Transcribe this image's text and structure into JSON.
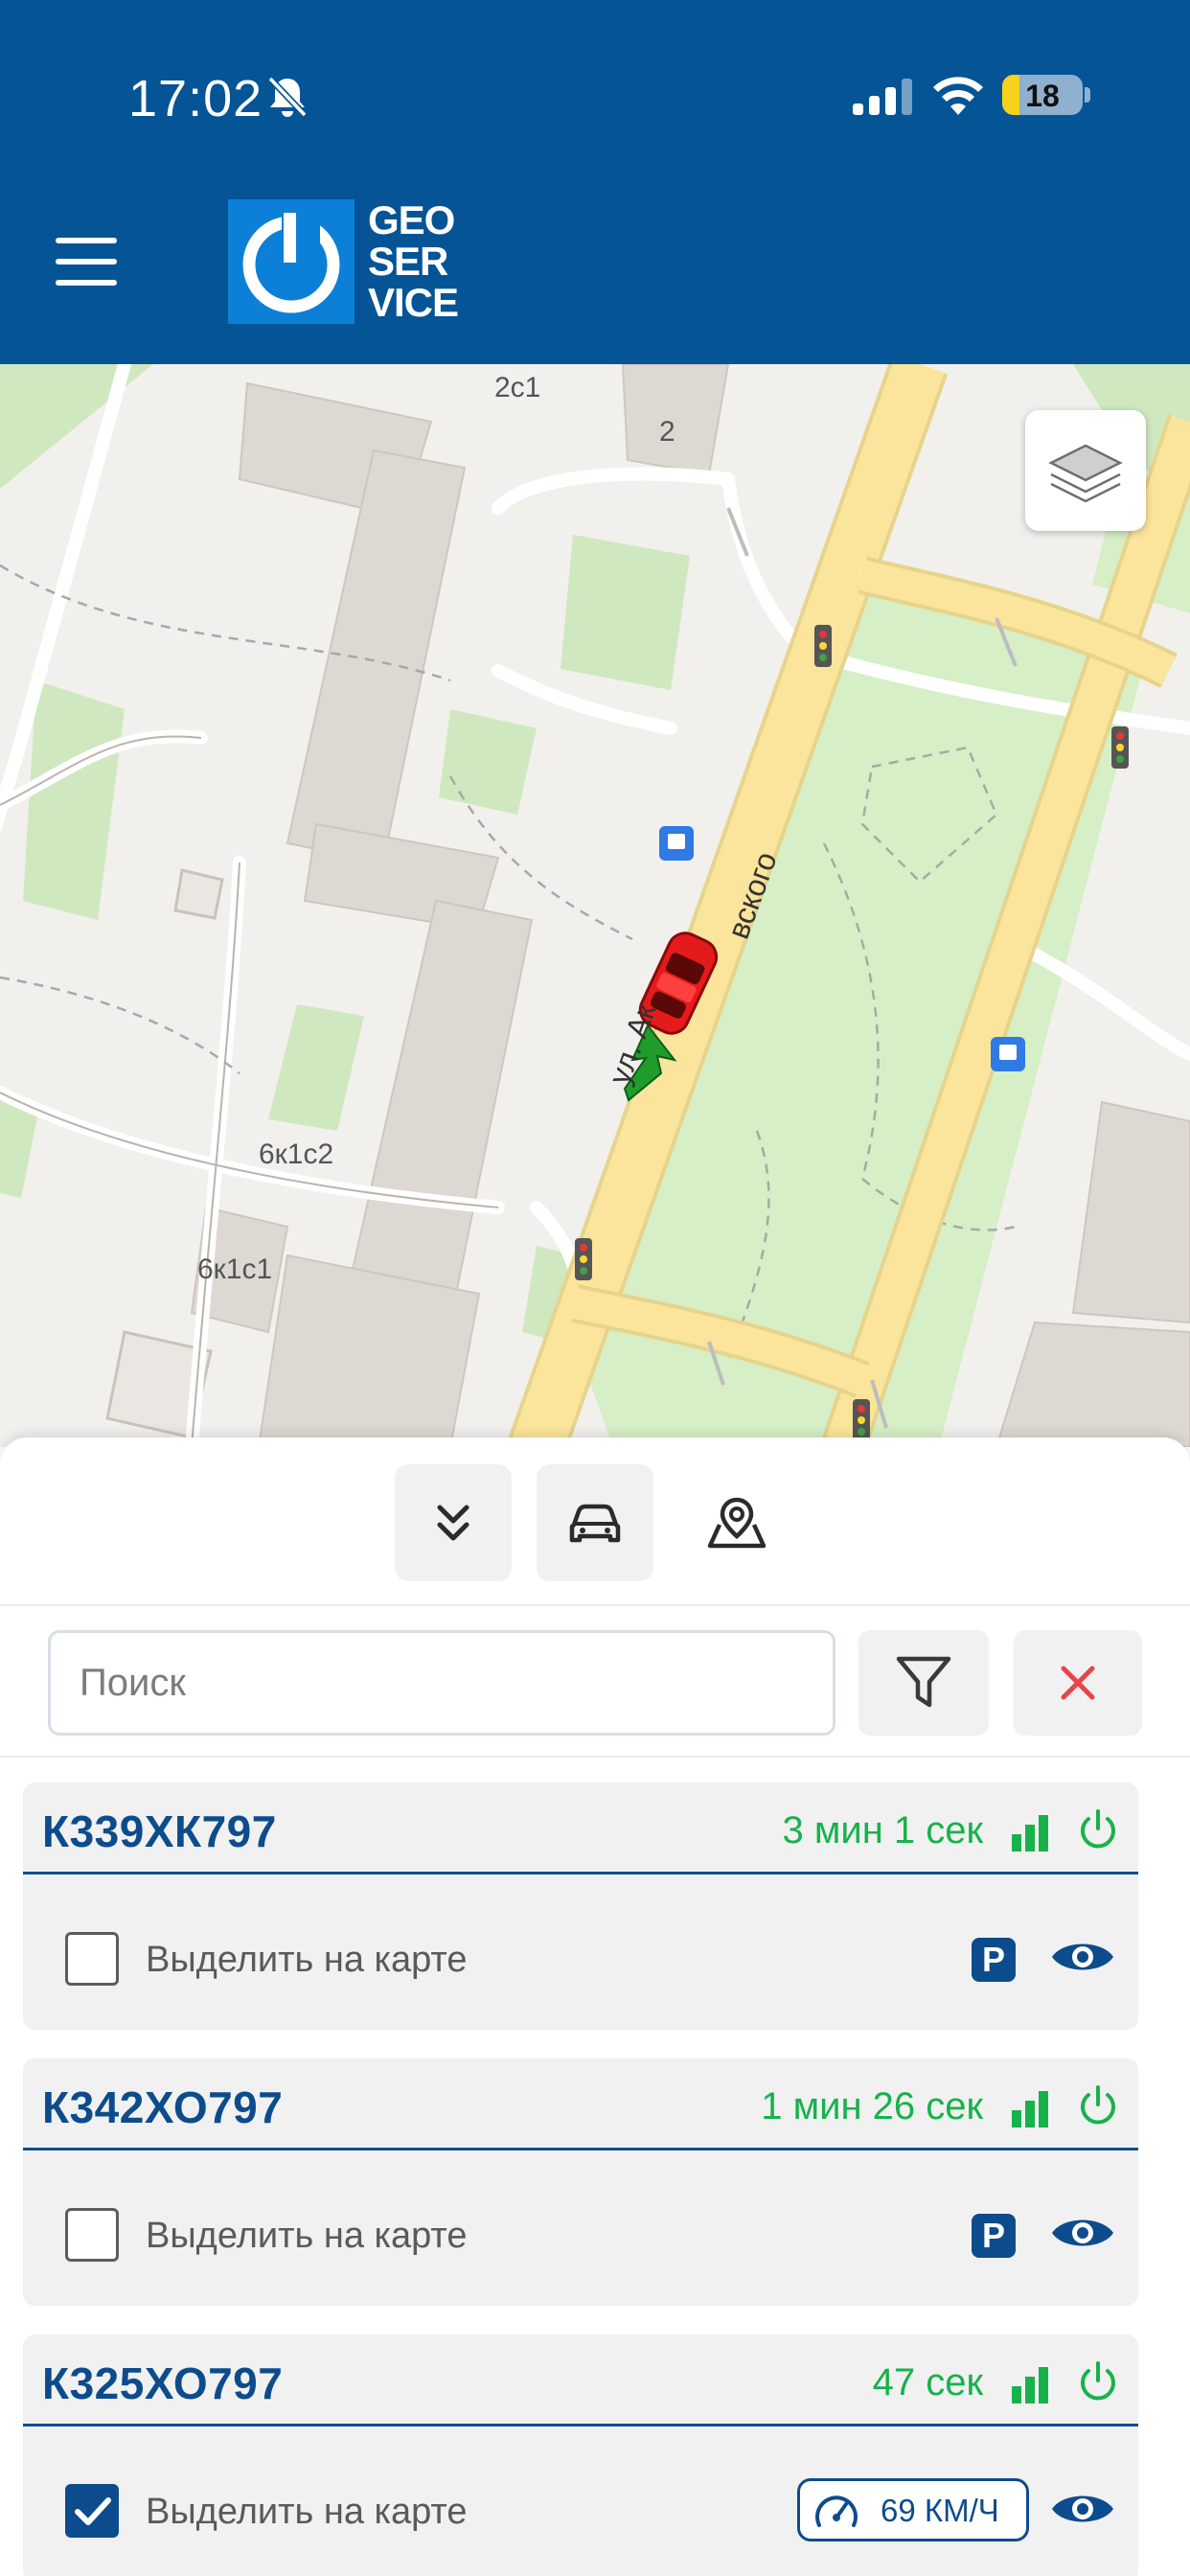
{
  "status_bar": {
    "time": "17:02",
    "battery": "18"
  },
  "header": {
    "logo_text": [
      "GEO",
      "SER",
      "VICE"
    ]
  },
  "map": {
    "labels": [
      "2с1",
      "2",
      "6к1с2",
      "6к1с1",
      "ул. Авиаторов",
      "ского"
    ],
    "street_label": "ул. Ак",
    "street_label_end": "вского"
  },
  "panel": {
    "search_placeholder": "Поиск",
    "vehicles": [
      {
        "plate": "К339ХК797",
        "duration": "3 мин 1 сек",
        "checkbox_label": "Выделить на карте",
        "checked": false,
        "status": "parked"
      },
      {
        "plate": "К342ХО797",
        "duration": "1 мин 26 сек",
        "checkbox_label": "Выделить на карте",
        "checked": false,
        "status": "parked"
      },
      {
        "plate": "К325ХО797",
        "duration": "47 сек",
        "checkbox_label": "Выделить на карте",
        "checked": true,
        "status": "moving",
        "speed": "69 КМ/Ч"
      }
    ]
  },
  "colors": {
    "header": "#045496",
    "brand_dark": "#0d4c8c",
    "online_green": "#17b24c",
    "clear_red": "#e8444a"
  }
}
